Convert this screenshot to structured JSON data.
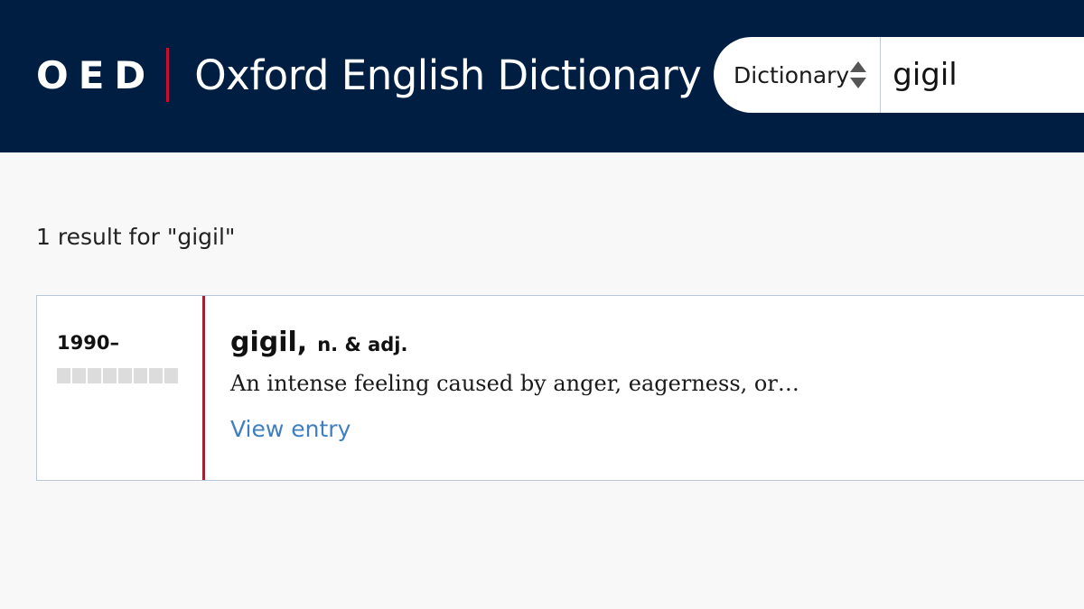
{
  "header": {
    "logo_abbr": "OED",
    "logo_name": "Oxford English Dictionary",
    "colors": {
      "background": "#001e41",
      "divider": "#c8102e"
    }
  },
  "search": {
    "type_selected": "Dictionary",
    "query": "gigil",
    "sort_icon": "sort-updown-icon"
  },
  "results": {
    "count_text": "1 result for \"gigil\"",
    "items": [
      {
        "date_range": "1990–",
        "frequency_level": 0,
        "headword": "gigil,",
        "part_of_speech": "n. & adj.",
        "definition": "An intense feeling caused by anger, eagerness, or…",
        "link_label": "View entry",
        "accent_color": "#a31f34",
        "link_color": "#3f7fbf"
      }
    ]
  }
}
